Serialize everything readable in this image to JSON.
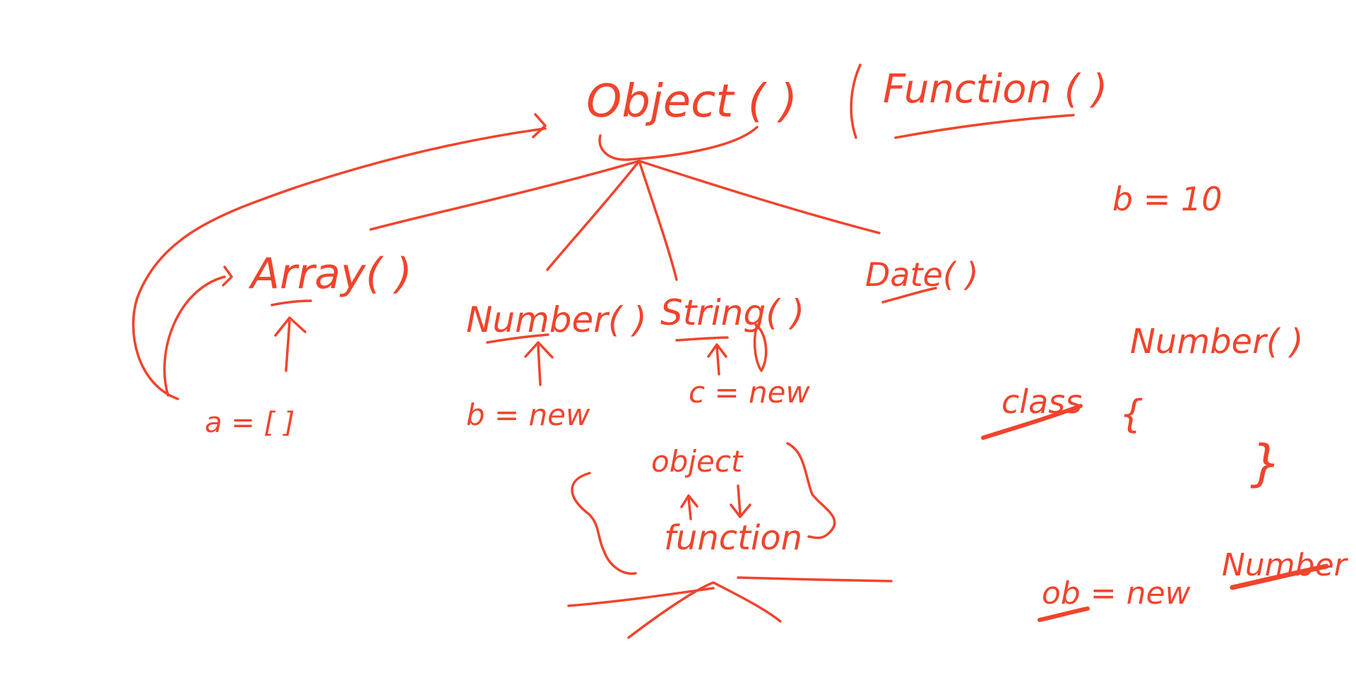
{
  "ink_color": "#f0442c",
  "background": "#ffffff",
  "labels": {
    "object": "Object ( )",
    "function": "Function ( )",
    "array": "Array( )",
    "number": "Number( )",
    "string": "String( )",
    "date": "Date( )",
    "a_assign": "a = [ ]",
    "b_assign": "b = new",
    "c_assign": "c = new",
    "object_small": "object",
    "function_small": "function",
    "b_ten": "b = 10",
    "class_kw": "class",
    "class_name": "Number( )",
    "open_brace": "{",
    "close_brace": "}",
    "ob_assign": "ob = new",
    "ob_number": "Number"
  }
}
